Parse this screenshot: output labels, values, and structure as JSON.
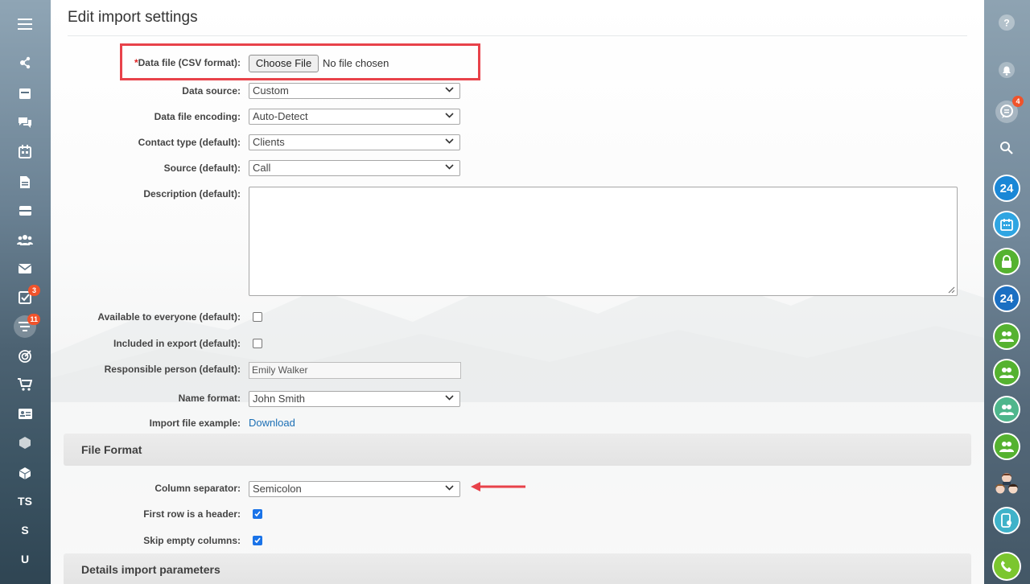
{
  "page": {
    "title": "Edit import settings"
  },
  "form": {
    "data_file": {
      "required_mark": "*",
      "label": "Data file (CSV format):",
      "button_label": "Choose File",
      "status": "No file chosen"
    },
    "data_source": {
      "label": "Data source:",
      "value": "Custom"
    },
    "encoding": {
      "label": "Data file encoding:",
      "value": "Auto-Detect"
    },
    "contact_type": {
      "label": "Contact type (default):",
      "value": "Clients"
    },
    "source": {
      "label": "Source (default):",
      "value": "Call"
    },
    "description": {
      "label": "Description (default):",
      "value": ""
    },
    "available_everyone": {
      "label": "Available to everyone (default):",
      "checked": false
    },
    "included_export": {
      "label": "Included in export (default):",
      "checked": false
    },
    "responsible": {
      "label": "Responsible person (default):",
      "value": "Emily Walker"
    },
    "name_format": {
      "label": "Name format:",
      "value": "John Smith"
    },
    "import_example": {
      "label": "Import file example:",
      "link": "Download"
    }
  },
  "file_format": {
    "title": "File Format",
    "column_separator": {
      "label": "Column separator:",
      "value": "Semicolon"
    },
    "first_row_header": {
      "label": "First row is a header:",
      "checked": true
    },
    "skip_empty": {
      "label": "Skip empty columns:",
      "checked": true
    }
  },
  "details_section": {
    "title": "Details import parameters"
  },
  "left_sidebar": {
    "items": [
      {
        "icon": "hamburger-menu-icon"
      },
      {
        "icon": "feed-icon"
      },
      {
        "icon": "calendar-card-icon"
      },
      {
        "icon": "chat-icon"
      },
      {
        "icon": "calendar-icon"
      },
      {
        "icon": "document-icon"
      },
      {
        "icon": "inbox-icon"
      },
      {
        "icon": "contacts-icon"
      },
      {
        "icon": "mail-icon"
      },
      {
        "icon": "tasks-icon",
        "badge": "3"
      },
      {
        "icon": "crm-filter-icon",
        "badge": "11"
      },
      {
        "icon": "target-icon"
      },
      {
        "icon": "cart-icon"
      },
      {
        "icon": "id-card-icon"
      },
      {
        "icon": "cube-icon"
      },
      {
        "icon": "cube-icon"
      },
      {
        "label": "TS"
      },
      {
        "label": "S"
      },
      {
        "label": "U"
      }
    ]
  },
  "right_sidebar": {
    "items": [
      {
        "icon": "help-icon"
      },
      {
        "icon": "bell-icon"
      },
      {
        "icon": "messenger-icon",
        "badge": "4"
      },
      {
        "icon": "search-icon"
      },
      {
        "icon": "bitrix24-icon",
        "label": "24"
      },
      {
        "icon": "calendar-icon"
      },
      {
        "icon": "lock-icon"
      },
      {
        "icon": "bitrix24-icon",
        "label": "24"
      },
      {
        "icon": "group-icon"
      },
      {
        "icon": "group-icon"
      },
      {
        "icon": "group-icon"
      },
      {
        "icon": "group-icon"
      },
      {
        "icon": "avatars-icon"
      },
      {
        "icon": "phone-device-icon"
      },
      {
        "icon": "phone-call-icon"
      }
    ]
  },
  "colors": {
    "highlight": "#e8424a",
    "link": "#1c6fb5",
    "checkbox": "#1a73e8",
    "badge": "#f0532b",
    "green": "#55b230",
    "blue": "#1b87d6"
  }
}
